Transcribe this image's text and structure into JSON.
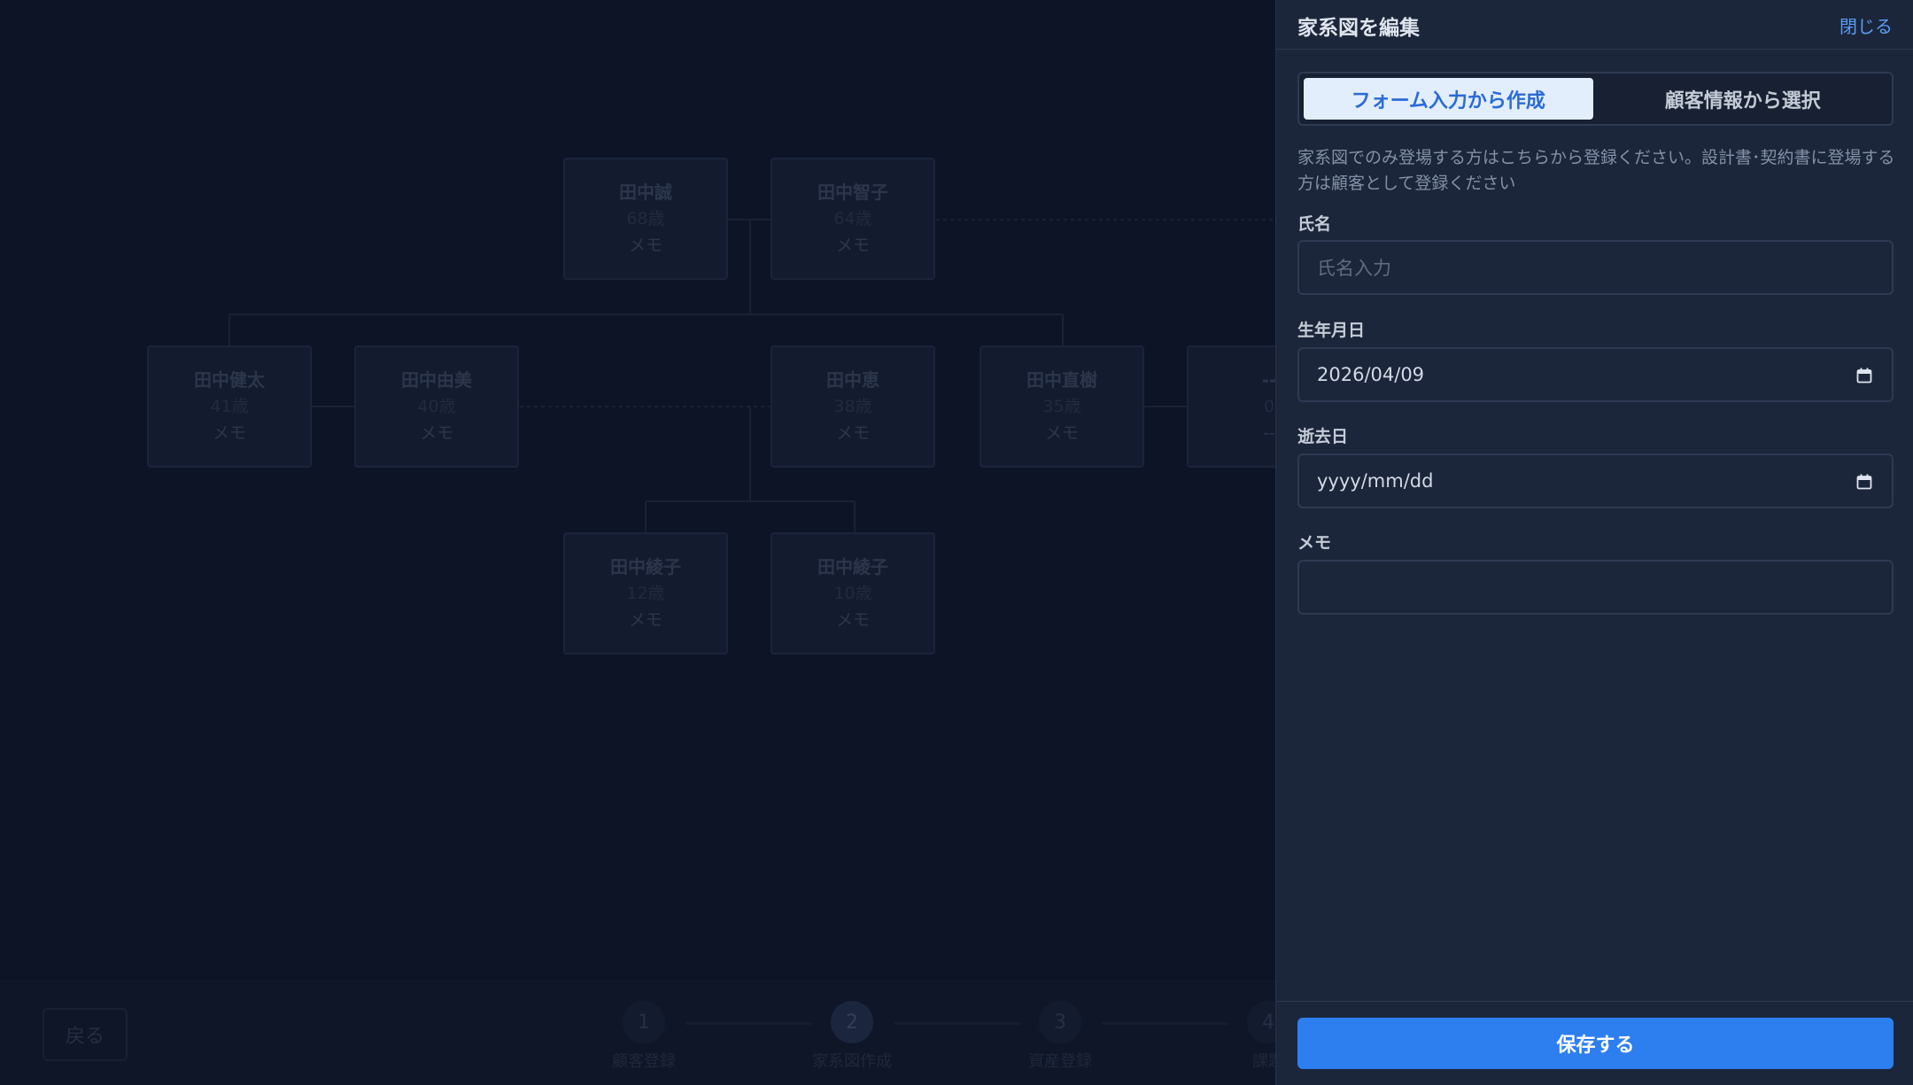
{
  "tree": {
    "people": [
      {
        "name": "田中誠",
        "age": "68歳",
        "memo": "メモ"
      },
      {
        "name": "田中智子",
        "age": "64歳",
        "memo": "メモ"
      },
      {
        "name": "田中健太",
        "age": "41歳",
        "memo": "メモ"
      },
      {
        "name": "田中由美",
        "age": "40歳",
        "memo": "メモ"
      },
      {
        "name": "田中恵",
        "age": "38歳",
        "memo": "メモ"
      },
      {
        "name": "田中直樹",
        "age": "35歳",
        "memo": "メモ"
      },
      {
        "name": "--",
        "age": "0",
        "memo": "--"
      },
      {
        "name": "田中綾子",
        "age": "12歳",
        "memo": "メモ"
      },
      {
        "name": "田中綾子",
        "age": "10歳",
        "memo": "メモ"
      }
    ]
  },
  "footer_nav": {
    "back_label": "戻る",
    "steps": [
      {
        "number": "1",
        "label": "顧客登録"
      },
      {
        "number": "2",
        "label": "家系図作成"
      },
      {
        "number": "3",
        "label": "資産登録"
      },
      {
        "number": "4",
        "label": "課題"
      }
    ],
    "active_step": 2
  },
  "panel": {
    "title": "家系図を編集",
    "close_label": "閉じる",
    "tabs": [
      {
        "label": "フォーム入力から作成",
        "active": true
      },
      {
        "label": "顧客情報から選択",
        "active": false
      }
    ],
    "description": "家系図でのみ登場する方はこちらから登録ください。設計書･契約書に登場する方は顧客として登録ください",
    "fields": {
      "name": {
        "label": "氏名",
        "placeholder": "氏名入力",
        "value": ""
      },
      "birth_date": {
        "label": "生年月日",
        "value": "2026/04/09",
        "icon": "calendar-icon"
      },
      "death_date": {
        "label": "逝去日",
        "placeholder": "yyyy/mm/dd",
        "value": "",
        "icon": "calendar-icon"
      },
      "memo": {
        "label": "メモ",
        "value": ""
      }
    },
    "save_label": "保存する"
  },
  "colors": {
    "accent": "#2d7ff0",
    "link": "#5b9cf5",
    "panel_bg": "#1b263a",
    "page_bg": "#0e1628"
  }
}
